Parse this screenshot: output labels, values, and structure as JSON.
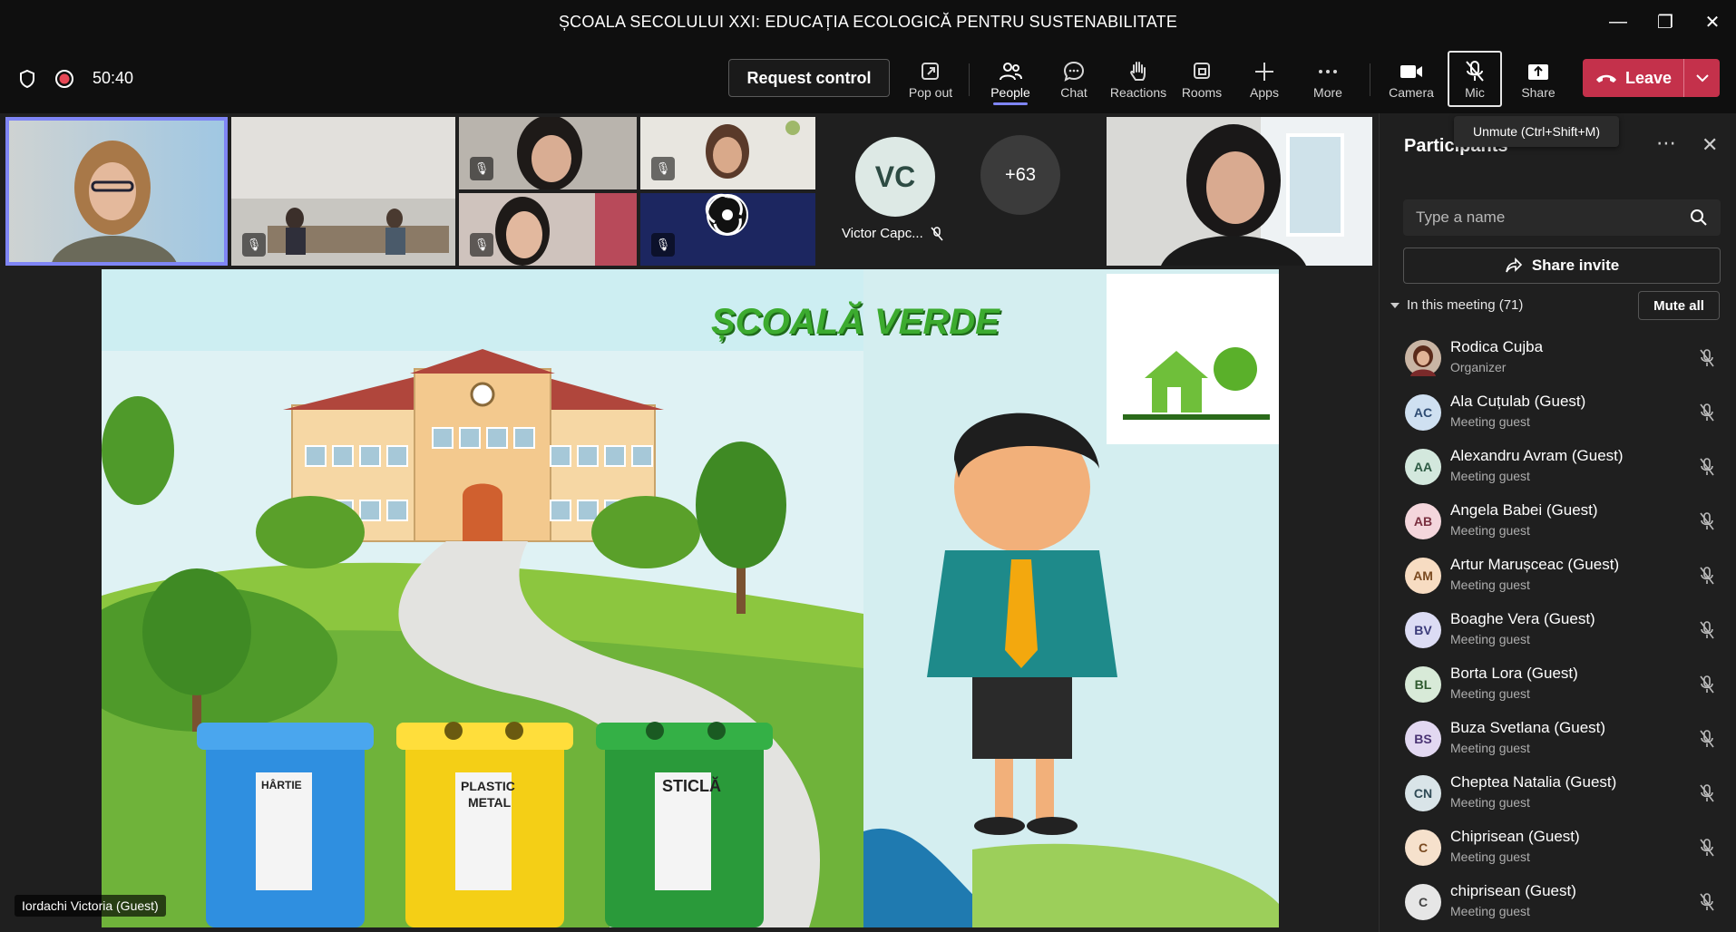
{
  "window": {
    "title": "ȘCOALA SECOLULUI XXI: EDUCAȚIA ECOLOGICĂ PENTRU SUSTENABILITATE",
    "minimize": "—",
    "maximize": "❐",
    "close": "✕"
  },
  "toolbar": {
    "timer": "50:40",
    "request_control": "Request control",
    "pop_out": "Pop out",
    "people": "People",
    "chat": "Chat",
    "reactions": "Reactions",
    "rooms": "Rooms",
    "apps": "Apps",
    "more": "More",
    "camera": "Camera",
    "mic": "Mic",
    "share": "Share",
    "leave": "Leave",
    "mic_tooltip": "Unmute (Ctrl+Shift+M)"
  },
  "gallery": {
    "vc_initials": "VC",
    "vc_name": "Victor Capc...",
    "overflow": "+63"
  },
  "stage": {
    "presenter": "Iordachi Victoria (Guest)",
    "slide_title": "ȘCOALĂ VERDE",
    "bin1": "HÂRTIE",
    "bin2a": "PLASTIC",
    "bin2b": "METAL",
    "bin3": "STICLĂ"
  },
  "panel": {
    "title": "Participants",
    "search_placeholder": "Type a name",
    "share_invite": "Share invite",
    "in_meeting": "In this meeting (71)",
    "mute_all": "Mute all",
    "participants": [
      {
        "name": "Rodica Cujba",
        "role": "Organizer",
        "initials": "",
        "bg": "#6b4a3a",
        "fg": "#fff"
      },
      {
        "name": "Ala Cuțulab (Guest)",
        "role": "Meeting guest",
        "initials": "AC",
        "bg": "#cfe0f1",
        "fg": "#2f4c73"
      },
      {
        "name": "Alexandru Avram (Guest)",
        "role": "Meeting guest",
        "initials": "AA",
        "bg": "#d3e8dd",
        "fg": "#2d5a43"
      },
      {
        "name": "Angela Babei (Guest)",
        "role": "Meeting guest",
        "initials": "AB",
        "bg": "#f4d6dc",
        "fg": "#7a3040"
      },
      {
        "name": "Artur Marușceac (Guest)",
        "role": "Meeting guest",
        "initials": "AM",
        "bg": "#f7dcc2",
        "fg": "#7a4a20"
      },
      {
        "name": "Boaghe Vera (Guest)",
        "role": "Meeting guest",
        "initials": "BV",
        "bg": "#dcdcf4",
        "fg": "#3b3b7a"
      },
      {
        "name": "Borta Lora (Guest)",
        "role": "Meeting guest",
        "initials": "BL",
        "bg": "#d8ead8",
        "fg": "#2f5a2f"
      },
      {
        "name": "Buza Svetlana (Guest)",
        "role": "Meeting guest",
        "initials": "BS",
        "bg": "#e2d8f1",
        "fg": "#4a3373"
      },
      {
        "name": "Cheptea Natalia (Guest)",
        "role": "Meeting guest",
        "initials": "CN",
        "bg": "#d9e4e8",
        "fg": "#2f4a55"
      },
      {
        "name": "Chiprisean (Guest)",
        "role": "Meeting guest",
        "initials": "C",
        "bg": "#f6e1cc",
        "fg": "#7a4a20"
      },
      {
        "name": "chiprisean (Guest)",
        "role": "Meeting guest",
        "initials": "C",
        "bg": "#e6e6e6",
        "fg": "#444"
      }
    ]
  }
}
